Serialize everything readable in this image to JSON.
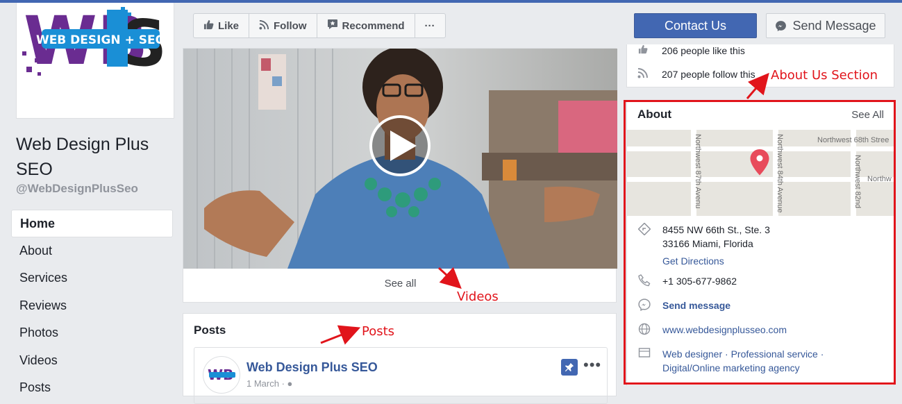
{
  "page": {
    "name": "Web Design Plus SEO",
    "handle": "@WebDesignPlusSeo",
    "logo_text": "WEB DESIGN + SEO"
  },
  "nav": {
    "items": [
      {
        "label": "Home",
        "active": true
      },
      {
        "label": "About"
      },
      {
        "label": "Services"
      },
      {
        "label": "Reviews"
      },
      {
        "label": "Photos"
      },
      {
        "label": "Videos"
      },
      {
        "label": "Posts"
      }
    ]
  },
  "actions": {
    "like": "Like",
    "follow": "Follow",
    "recommend": "Recommend",
    "more": "···",
    "contact": "Contact Us",
    "send_message": "Send Message"
  },
  "video": {
    "see_all": "See all"
  },
  "posts": {
    "title": "Posts",
    "post": {
      "author": "Web Design Plus SEO",
      "date": "1 March ·"
    }
  },
  "stats": {
    "likes": "206 people like this",
    "follows": "207 people follow this"
  },
  "about": {
    "title": "About",
    "see_all": "See All",
    "map_labels": {
      "street1": "Northwest 68th Stree",
      "street2": "Northwest 87th Avenu",
      "street3": "Northwest 84th Avenue",
      "street4": "Northwest 82nd",
      "street5": "Northw"
    },
    "address_line1": "8455 NW 66th St., Ste. 3",
    "address_line2": "33166 Miami, Florida",
    "directions": "Get Directions",
    "phone": "+1 305-677-9862",
    "message": "Send message",
    "website": "www.webdesignplusseo.com",
    "category_line1": "Web designer · Professional service ·",
    "category_line2": "Digital/Online marketing agency"
  },
  "annotations": {
    "about_section": "About Us Section",
    "videos": "Videos",
    "posts": "Posts"
  },
  "colors": {
    "facebook_blue": "#4267b2",
    "link_blue": "#365899",
    "annotation_red": "#e1141b",
    "logo_purple": "#6a2c91",
    "logo_blue": "#1a8fd6"
  }
}
